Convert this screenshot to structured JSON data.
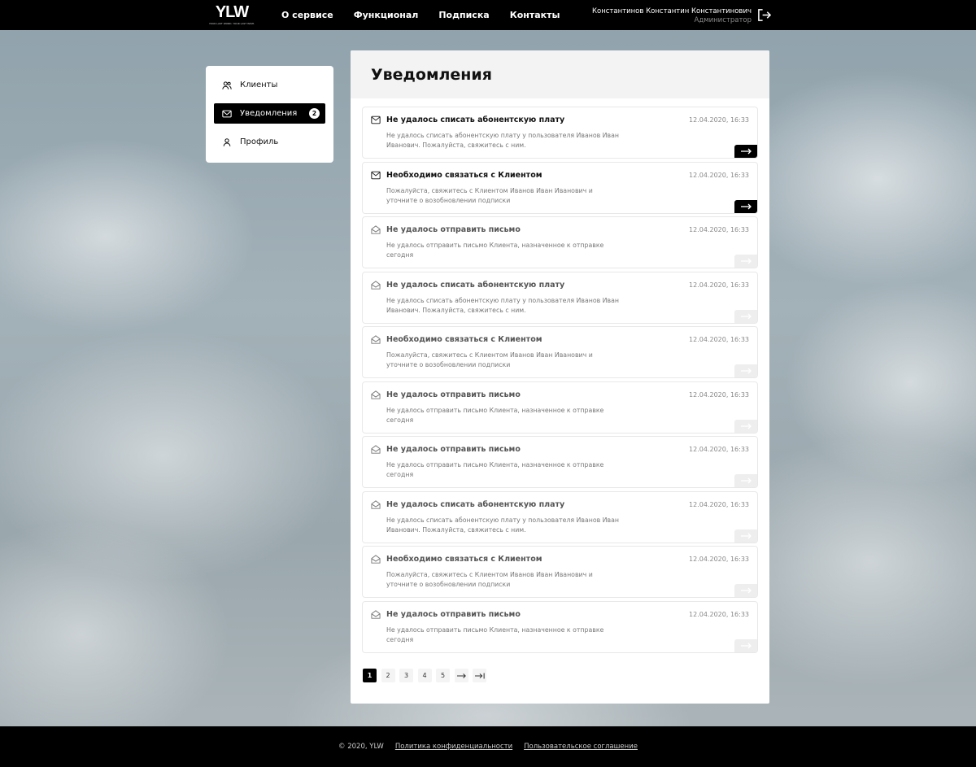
{
  "header": {
    "logo": "YLW",
    "logo_tagline": "YOUR LAST WORD. YOUR LAST WISH.",
    "nav": [
      "О сервисе",
      "Функционал",
      "Подписка",
      "Контакты"
    ],
    "user_name": "Константинов Константин Константинович",
    "user_role": "Администратор"
  },
  "sidebar": {
    "items": [
      {
        "label": "Клиенты",
        "icon": "users-icon"
      },
      {
        "label": "Уведомления",
        "icon": "mail-icon",
        "badge": "2",
        "active": true
      },
      {
        "label": "Профиль",
        "icon": "user-icon"
      }
    ]
  },
  "panel": {
    "title": "Уведомления",
    "notifications": [
      {
        "title": "Не удалось списать абонентскую плату",
        "date": "12.04.2020, 16:33",
        "text": "Не удалось списать абонентскую плату у пользователя Иванов Иван Иванович. Пожалуйста, свяжитесь с ним.",
        "read": false
      },
      {
        "title": "Необходимо связаться с Клиентом",
        "date": "12.04.2020, 16:33",
        "text": "Пожалуйста, свяжитесь с Клиентом Иванов Иван Иванович и уточните о возобновлении подписки",
        "read": false
      },
      {
        "title": "Не удалось отправить письмо",
        "date": "12.04.2020, 16:33",
        "text": "Не удалось отправить письмо Клиента, назначенное к отправке сегодня",
        "read": true
      },
      {
        "title": "Не удалось списать абонентскую плату",
        "date": "12.04.2020, 16:33",
        "text": "Не удалось списать абонентскую плату у пользователя Иванов Иван Иванович. Пожалуйста, свяжитесь с ним.",
        "read": true
      },
      {
        "title": "Необходимо связаться с Клиентом",
        "date": "12.04.2020, 16:33",
        "text": "Пожалуйста, свяжитесь с Клиентом Иванов Иван Иванович и уточните о возобновлении подписки",
        "read": true
      },
      {
        "title": "Не удалось отправить письмо",
        "date": "12.04.2020, 16:33",
        "text": "Не удалось отправить письмо Клиента, назначенное к отправке сегодня",
        "read": true
      },
      {
        "title": "Не удалось отправить письмо",
        "date": "12.04.2020, 16:33",
        "text": "Не удалось отправить письмо Клиента, назначенное к отправке сегодня",
        "read": true
      },
      {
        "title": "Не удалось списать абонентскую плату",
        "date": "12.04.2020, 16:33",
        "text": "Не удалось списать абонентскую плату у пользователя Иванов Иван Иванович. Пожалуйста, свяжитесь с ним.",
        "read": true
      },
      {
        "title": "Необходимо связаться с Клиентом",
        "date": "12.04.2020, 16:33",
        "text": "Пожалуйста, свяжитесь с Клиентом Иванов Иван Иванович и уточните о возобновлении подписки",
        "read": true
      },
      {
        "title": "Не удалось отправить письмо",
        "date": "12.04.2020, 16:33",
        "text": "Не удалось отправить письмо Клиента, назначенное к отправке сегодня",
        "read": true
      }
    ]
  },
  "pagination": {
    "pages": [
      "1",
      "2",
      "3",
      "4",
      "5"
    ],
    "active": "1",
    "next_icon": "arrow-right-icon",
    "last_icon": "arrow-right-to-bar-icon"
  },
  "footer": {
    "copyright": "© 2020, YLW",
    "privacy": "Политика конфиденциальности",
    "terms": "Пользовательское соглашение"
  }
}
